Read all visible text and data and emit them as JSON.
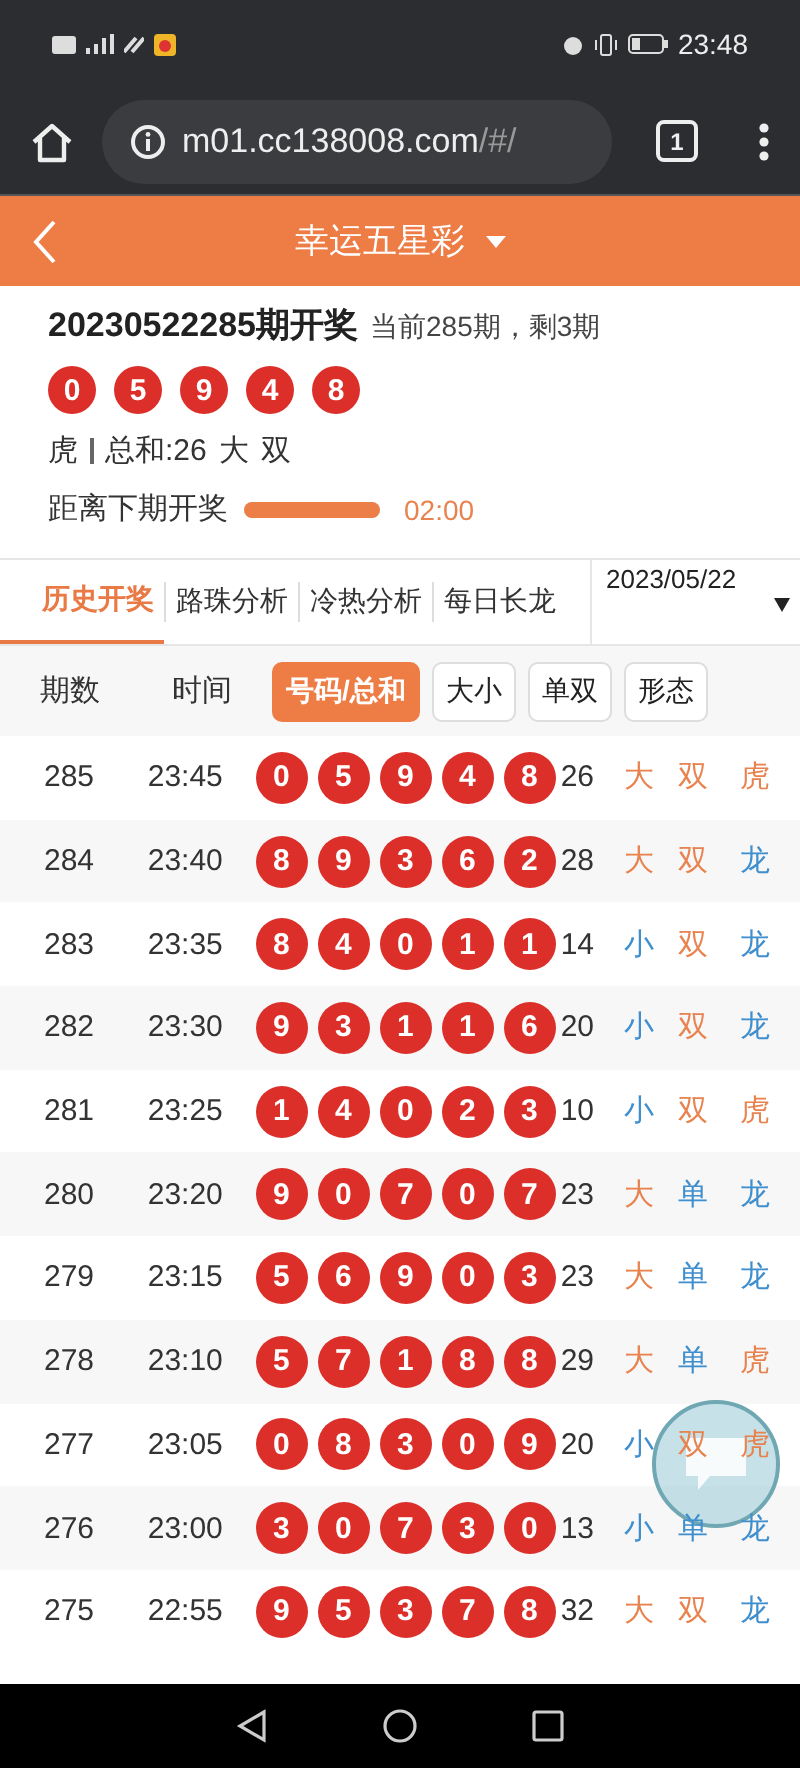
{
  "status_bar": {
    "time": "23:48"
  },
  "browser": {
    "host": "m01.cc138008.com",
    "path": "/#/",
    "tab_count": "1"
  },
  "header": {
    "title": "幸运五星彩"
  },
  "draw": {
    "title": "20230522285期开奖",
    "subtitle": "当前285期，剩3期",
    "balls": [
      "0",
      "5",
      "9",
      "4",
      "8"
    ],
    "summary": [
      "虎",
      "总和:26",
      "大",
      "双"
    ],
    "countdown": {
      "label": "距离下期开奖",
      "level": 1,
      "time": "02:00"
    }
  },
  "tabs": [
    {
      "label": "历史开奖",
      "selected": true
    },
    {
      "label": "路珠分析",
      "selected": false
    },
    {
      "label": "冷热分析",
      "selected": false
    },
    {
      "label": "每日长龙",
      "selected": false
    }
  ],
  "date_select": {
    "value": "2023/05/22"
  },
  "columns": [
    {
      "label": "期数",
      "kind": "text"
    },
    {
      "label": "时间",
      "kind": "text"
    },
    {
      "label": "号码/总和",
      "kind": "toggle",
      "selected": true
    },
    {
      "label": "大小",
      "kind": "toggle",
      "selected": false
    },
    {
      "label": "单双",
      "kind": "toggle",
      "selected": false
    },
    {
      "label": "形态",
      "kind": "toggle",
      "selected": false
    }
  ],
  "rows": [
    {
      "issue": "285",
      "time": "23:45",
      "balls": [
        "0",
        "5",
        "9",
        "4",
        "8"
      ],
      "sum": "26",
      "tags": [
        {
          "text": "大",
          "color": "#e8834f"
        },
        {
          "text": "双",
          "color": "#e8834f"
        },
        {
          "text": "虎",
          "color": "#e8834f"
        }
      ]
    },
    {
      "issue": "284",
      "time": "23:40",
      "balls": [
        "8",
        "9",
        "3",
        "6",
        "2"
      ],
      "sum": "28",
      "tags": [
        {
          "text": "大",
          "color": "#e8834f"
        },
        {
          "text": "双",
          "color": "#e8834f"
        },
        {
          "text": "龙",
          "color": "#3f8fcf"
        }
      ]
    },
    {
      "issue": "283",
      "time": "23:35",
      "balls": [
        "8",
        "4",
        "0",
        "1",
        "1"
      ],
      "sum": "14",
      "tags": [
        {
          "text": "小",
          "color": "#3f8fcf"
        },
        {
          "text": "双",
          "color": "#e8834f"
        },
        {
          "text": "龙",
          "color": "#3f8fcf"
        }
      ]
    },
    {
      "issue": "282",
      "time": "23:30",
      "balls": [
        "9",
        "3",
        "1",
        "1",
        "6"
      ],
      "sum": "20",
      "tags": [
        {
          "text": "小",
          "color": "#3f8fcf"
        },
        {
          "text": "双",
          "color": "#e8834f"
        },
        {
          "text": "龙",
          "color": "#3f8fcf"
        }
      ]
    },
    {
      "issue": "281",
      "time": "23:25",
      "balls": [
        "1",
        "4",
        "0",
        "2",
        "3"
      ],
      "sum": "10",
      "tags": [
        {
          "text": "小",
          "color": "#3f8fcf"
        },
        {
          "text": "双",
          "color": "#e8834f"
        },
        {
          "text": "虎",
          "color": "#e8834f"
        }
      ]
    },
    {
      "issue": "280",
      "time": "23:20",
      "balls": [
        "9",
        "0",
        "7",
        "0",
        "7"
      ],
      "sum": "23",
      "tags": [
        {
          "text": "大",
          "color": "#e8834f"
        },
        {
          "text": "单",
          "color": "#3f8fcf"
        },
        {
          "text": "龙",
          "color": "#3f8fcf"
        }
      ]
    },
    {
      "issue": "279",
      "time": "23:15",
      "balls": [
        "5",
        "6",
        "9",
        "0",
        "3"
      ],
      "sum": "23",
      "tags": [
        {
          "text": "大",
          "color": "#e8834f"
        },
        {
          "text": "单",
          "color": "#3f8fcf"
        },
        {
          "text": "龙",
          "color": "#3f8fcf"
        }
      ]
    },
    {
      "issue": "278",
      "time": "23:10",
      "balls": [
        "5",
        "7",
        "1",
        "8",
        "8"
      ],
      "sum": "29",
      "tags": [
        {
          "text": "大",
          "color": "#e8834f"
        },
        {
          "text": "单",
          "color": "#3f8fcf"
        },
        {
          "text": "虎",
          "color": "#e8834f"
        }
      ]
    },
    {
      "issue": "277",
      "time": "23:05",
      "balls": [
        "0",
        "8",
        "3",
        "0",
        "9"
      ],
      "sum": "20",
      "tags": [
        {
          "text": "小",
          "color": "#3f8fcf"
        },
        {
          "text": "双",
          "color": "#e8834f"
        },
        {
          "text": "虎",
          "color": "#e8834f"
        }
      ]
    },
    {
      "issue": "276",
      "time": "23:00",
      "balls": [
        "3",
        "0",
        "7",
        "3",
        "0"
      ],
      "sum": "13",
      "tags": [
        {
          "text": "小",
          "color": "#3f8fcf"
        },
        {
          "text": "单",
          "color": "#3f8fcf"
        },
        {
          "text": "龙",
          "color": "#3f8fcf"
        }
      ]
    },
    {
      "issue": "275",
      "time": "22:55",
      "balls": [
        "9",
        "5",
        "3",
        "7",
        "8"
      ],
      "sum": "32",
      "tags": [
        {
          "text": "大",
          "color": "#e8834f"
        },
        {
          "text": "双",
          "color": "#e8834f"
        },
        {
          "text": "龙",
          "color": "#3f8fcf"
        }
      ]
    }
  ]
}
